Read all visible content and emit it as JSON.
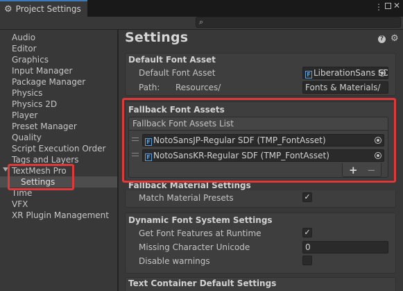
{
  "window": {
    "tab_title": "Project Settings",
    "tab_icon": "gear-icon",
    "menu_glyph": "⋮",
    "close_glyph": "✕"
  },
  "search": {
    "placeholder": ""
  },
  "sidebar": {
    "items": [
      {
        "label": "Audio"
      },
      {
        "label": "Editor"
      },
      {
        "label": "Graphics"
      },
      {
        "label": "Input Manager"
      },
      {
        "label": "Package Manager"
      },
      {
        "label": "Physics"
      },
      {
        "label": "Physics 2D"
      },
      {
        "label": "Player"
      },
      {
        "label": "Preset Manager"
      },
      {
        "label": "Quality"
      },
      {
        "label": "Script Execution Order"
      },
      {
        "label": "Tags and Layers"
      },
      {
        "label": "TextMesh Pro"
      },
      {
        "label": "Settings"
      },
      {
        "label": "Time"
      },
      {
        "label": "VFX"
      },
      {
        "label": "XR Plugin Management"
      }
    ],
    "selected": "Settings"
  },
  "main": {
    "title": "Settings",
    "default_font_asset": {
      "header": "Default Font Asset",
      "font_label": "Default Font Asset",
      "font_value": "LiberationSans SDF",
      "path_label": "Path:",
      "path_prefix": "Resources/",
      "path_value": "Fonts & Materials/"
    },
    "fallback_font_assets": {
      "header": "Fallback Font Assets",
      "list_header": "Fallback Font Assets List",
      "items": [
        {
          "label": "NotoSansJP-Regular SDF (TMP_FontAsset)"
        },
        {
          "label": "NotoSansKR-Regular SDF (TMP_FontAsset)"
        }
      ],
      "add_label": "+",
      "remove_label": "−"
    },
    "fallback_material": {
      "header": "Fallback Material Settings",
      "match_label": "Match Material Presets",
      "match_checked": true
    },
    "dynamic_font": {
      "header": "Dynamic Font System Settings",
      "features_label": "Get Font Features at Runtime",
      "features_checked": true,
      "missing_label": "Missing Character Unicode",
      "missing_value": "0",
      "warnings_label": "Disable warnings",
      "warnings_checked": false
    },
    "text_container": {
      "header": "Text Container Default Settings"
    }
  },
  "colors": {
    "highlight": "#e0393a",
    "background": "#383838",
    "selected_row": "#4d4d4d",
    "tmp_icon": "#5aa0e0"
  }
}
